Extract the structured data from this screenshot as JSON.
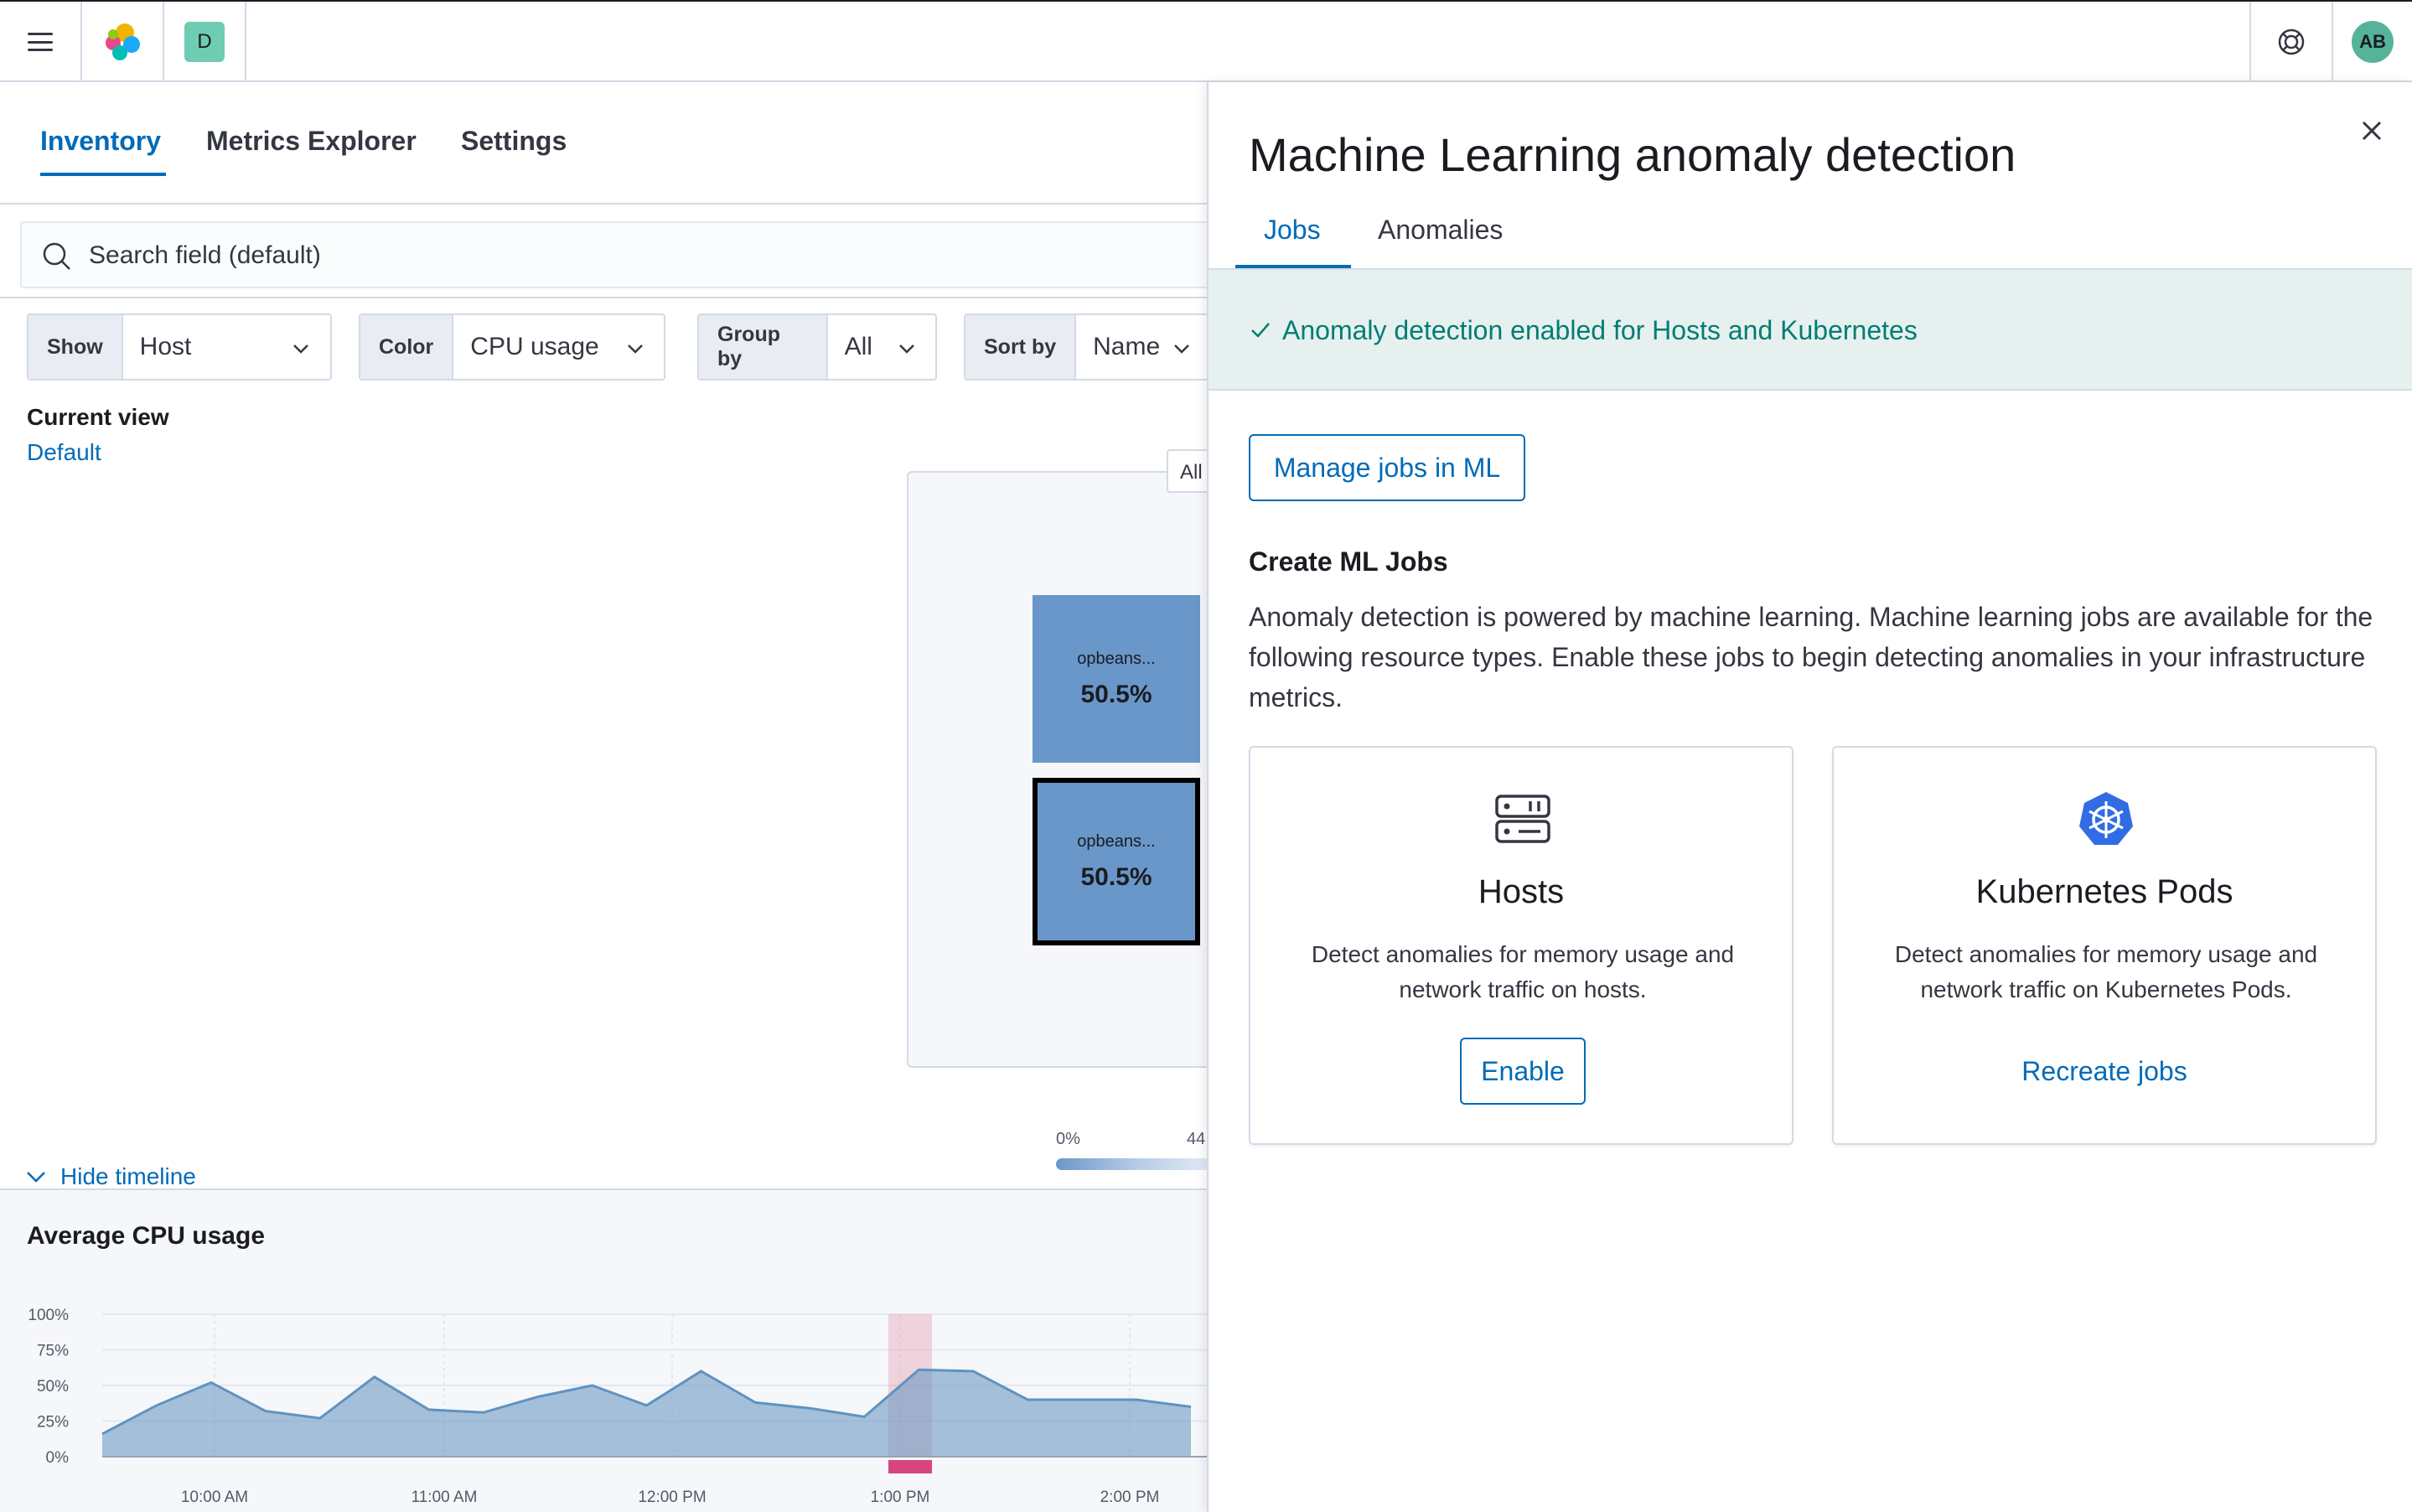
{
  "header": {
    "space_letter": "D",
    "user_initials": "AB"
  },
  "app": {
    "tabs": [
      {
        "label": "Inventory",
        "active": true
      },
      {
        "label": "Metrics Explorer",
        "active": false
      },
      {
        "label": "Settings",
        "active": false
      }
    ],
    "search": {
      "placeholder": "Search field (default)"
    },
    "controls": [
      {
        "label": "Show",
        "value": "Host"
      },
      {
        "label": "Color",
        "value": "CPU usage"
      },
      {
        "label": "Group by",
        "value": "All"
      },
      {
        "label": "Sort by",
        "value": "Name"
      }
    ],
    "current_view": {
      "label": "Current view",
      "value": "Default"
    },
    "map": {
      "all_button": "All",
      "nodes": [
        {
          "name": "opbeans...",
          "value": "50.5%",
          "selected": false
        },
        {
          "name": "opbeans...",
          "value": "50.5%",
          "selected": true
        }
      ],
      "legend": {
        "min": "0%",
        "max": "44"
      }
    },
    "hide_timeline": "Hide timeline",
    "timeline": {
      "title": "Average CPU usage",
      "chart_data": {
        "type": "area",
        "title": "Average CPU usage",
        "yticks": [
          "100%",
          "75%",
          "50%",
          "25%",
          "0%"
        ],
        "xticks": [
          "10:00 AM",
          "11:00 AM",
          "12:00 PM",
          "1:00 PM",
          "2:00 PM"
        ],
        "ylim": [
          0,
          100
        ],
        "series": [
          {
            "values": [
              16,
              36,
              52,
              32,
              27,
              56,
              33,
              31,
              42,
              50,
              36,
              60,
              38,
              34,
              28,
              61,
              60,
              40,
              40,
              40,
              35
            ]
          }
        ],
        "highlight_color": "#e7a5b8",
        "series_color": "#6092c0"
      }
    }
  },
  "flyout": {
    "title": "Machine Learning anomaly detection",
    "tabs": [
      {
        "label": "Jobs",
        "active": true
      },
      {
        "label": "Anomalies",
        "active": false
      }
    ],
    "callout": "Anomaly detection enabled for Hosts and Kubernetes",
    "manage_button": "Manage jobs in ML",
    "create_title": "Create ML Jobs",
    "create_desc": "Anomaly detection is powered by machine learning. Machine learning jobs are available for the following resource types. Enable these jobs to begin detecting anomalies in your infrastructure metrics.",
    "cards": [
      {
        "title": "Hosts",
        "desc": "Detect anomalies for memory usage and network traffic on hosts.",
        "button": "Enable",
        "icon": "server-icon"
      },
      {
        "title": "Kubernetes Pods",
        "desc": "Detect anomalies for memory usage and network traffic on Kubernetes Pods.",
        "button": "Recreate jobs",
        "icon": "kubernetes-icon"
      }
    ]
  }
}
